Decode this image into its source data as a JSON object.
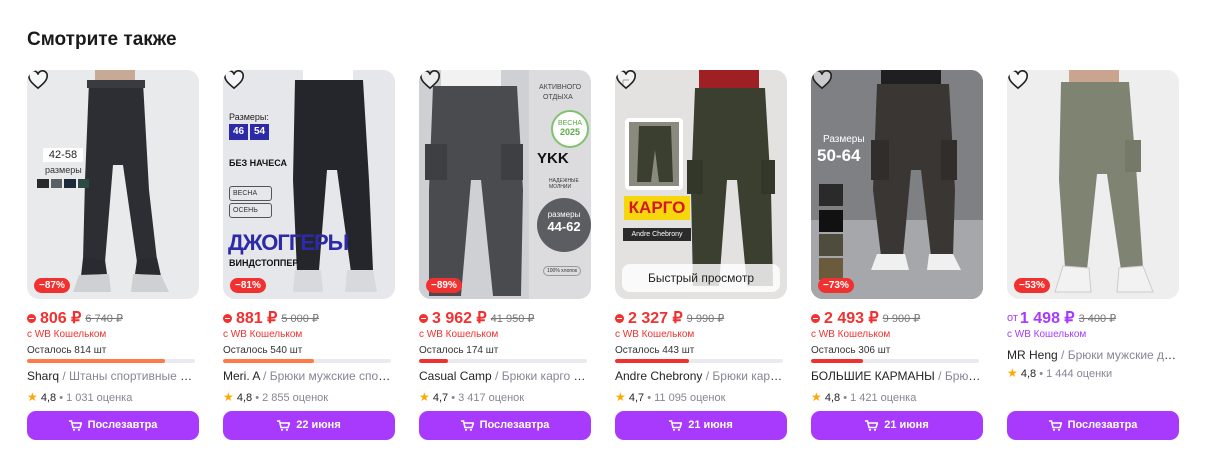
{
  "section_title": "Смотрите также",
  "quick_view": "Быстрый просмотр",
  "products": [
    {
      "discount": "−87%",
      "price": "806 ₽",
      "old_price": "6 740 ₽",
      "price_prefix": "",
      "wallet": "с WB Кошельком",
      "stock": "Осталось 814 шт",
      "stock_fraction": 0.82,
      "brand": "Sharq",
      "category": "/ Штаны спортивные без…",
      "rating": "4,8",
      "reviews": "• 1 031 оценка",
      "delivery": "Послезавтра",
      "overlay": {
        "sizes": "42-58",
        "sizes_label": "размеры"
      }
    },
    {
      "discount": "−81%",
      "price": "881 ₽",
      "old_price": "5 000 ₽",
      "price_prefix": "",
      "wallet": "с WB Кошельком",
      "stock": "Осталось 540 шт",
      "stock_fraction": 0.54,
      "brand": "Meri. A",
      "category": "/ Брюки мужские спорт…",
      "rating": "4,8",
      "reviews": "• 2 855 оценок",
      "delivery": "22 июня",
      "overlay": {
        "sizes_label": "Размеры:",
        "size_a": "46",
        "size_b": "54",
        "no_fleece": "БЕЗ НАЧЕСА",
        "spring": "ВЕСНА",
        "autumn": "ОСЕНЬ",
        "joggers": "ДЖОГГЕРЫ",
        "windstopper": "ВИНДСТОППЕР"
      }
    },
    {
      "discount": "−89%",
      "price": "3 962 ₽",
      "old_price": "41 950 ₽",
      "price_prefix": "",
      "wallet": "с WB Кошельком",
      "stock": "Осталось 174 шт",
      "stock_fraction": 0.17,
      "brand": "Casual Camp",
      "category": "/ Брюки карго пр…",
      "rating": "4,7",
      "reviews": "• 3 417 оценок",
      "delivery": "Послезавтра",
      "overlay": {
        "active": "АКТИВНОГО",
        "rest": "ОТДЫХА",
        "spring": "ВЕСНА",
        "year": "2025",
        "ykk": "YKK",
        "zippers": "НАДЕЖНЫЕ МОЛНИИ",
        "sizes_label": "размеры",
        "sizes": "44-62",
        "cotton": "100% хлопок"
      }
    },
    {
      "discount": "",
      "price": "2 327 ₽",
      "old_price": "9 990 ₽",
      "price_prefix": "",
      "wallet": "с WB Кошельком",
      "stock": "Осталось 443 шт",
      "stock_fraction": 0.44,
      "brand": "Andre Chebrony",
      "category": "/ Брюки карго …",
      "rating": "4,7",
      "reviews": "• 11 095 оценок",
      "delivery": "21 июня",
      "overlay": {
        "cargo": "КАРГО",
        "brand": "Andre Chebrony"
      }
    },
    {
      "discount": "−73%",
      "price": "2 493 ₽",
      "old_price": "9 900 ₽",
      "price_prefix": "",
      "wallet": "с WB Кошельком",
      "stock": "Осталось 306 шт",
      "stock_fraction": 0.31,
      "brand": "БОЛЬШИЕ КАРМАНЫ",
      "category": "/ Брюки …",
      "rating": "4,8",
      "reviews": "• 1 421 оценка",
      "delivery": "21 июня",
      "overlay": {
        "sizes_label": "Размеры",
        "sizes": "50-64"
      }
    },
    {
      "discount": "−53%",
      "price": "1 498 ₽",
      "old_price": "3 400 ₽",
      "price_prefix": "от",
      "wallet": "с WB Кошельком",
      "stock": "",
      "stock_fraction": 0,
      "brand": "MR Heng",
      "category": "/ Брюки мужские дж…",
      "rating": "4,8",
      "reviews": "• 1 444 оценки",
      "delivery": "Послезавтра",
      "overlay": {}
    }
  ],
  "colors": {
    "accent": "#a73afd",
    "sale": "#f0312f",
    "stock_bar": "#ff7a45"
  }
}
